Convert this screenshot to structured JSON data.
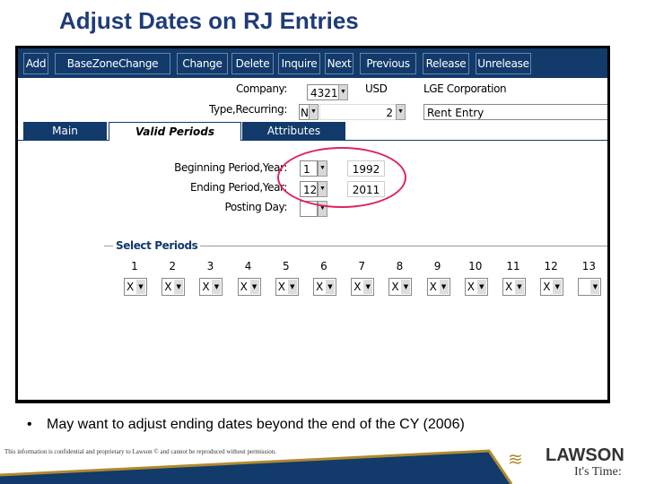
{
  "title": "Adjust Dates on RJ Entries",
  "toolbar": [
    "Add",
    "BaseZoneChange",
    "Change",
    "Delete",
    "Inquire",
    "Next",
    "Previous",
    "Release",
    "Unrelease"
  ],
  "form": {
    "company_label": "Company:",
    "company": "4321",
    "currency": "USD",
    "company_name": "LGE Corporation",
    "type_label": "Type,Recurring:",
    "type": "N",
    "recurring": "2",
    "description": "Rent Entry"
  },
  "tabs": [
    "Main",
    "Valid Periods",
    "Attributes"
  ],
  "periods": {
    "begin_label": "Beginning Period,Year:",
    "begin_period": "1",
    "begin_year": "1992",
    "end_label": "Ending Period,Year:",
    "end_period": "12",
    "end_year": "2011",
    "posting_label": "Posting Day:",
    "posting_day": ""
  },
  "select_periods": {
    "label": "Select Periods",
    "numbers": [
      "1",
      "2",
      "3",
      "4",
      "5",
      "6",
      "7",
      "8",
      "9",
      "10",
      "11",
      "12",
      "13"
    ],
    "values": [
      "X",
      "X",
      "X",
      "X",
      "X",
      "X",
      "X",
      "X",
      "X",
      "X",
      "X",
      "X",
      ""
    ]
  },
  "highlight_color": "#e0206a",
  "bullet": "•",
  "note": "May want to adjust ending dates beyond the end of the CY (2006)",
  "legal": "This information is confidential and proprietary to Lawson © and cannot be reproduced without permission.",
  "logo": {
    "name": "LAWSON",
    "tagline": "It's Time:"
  }
}
